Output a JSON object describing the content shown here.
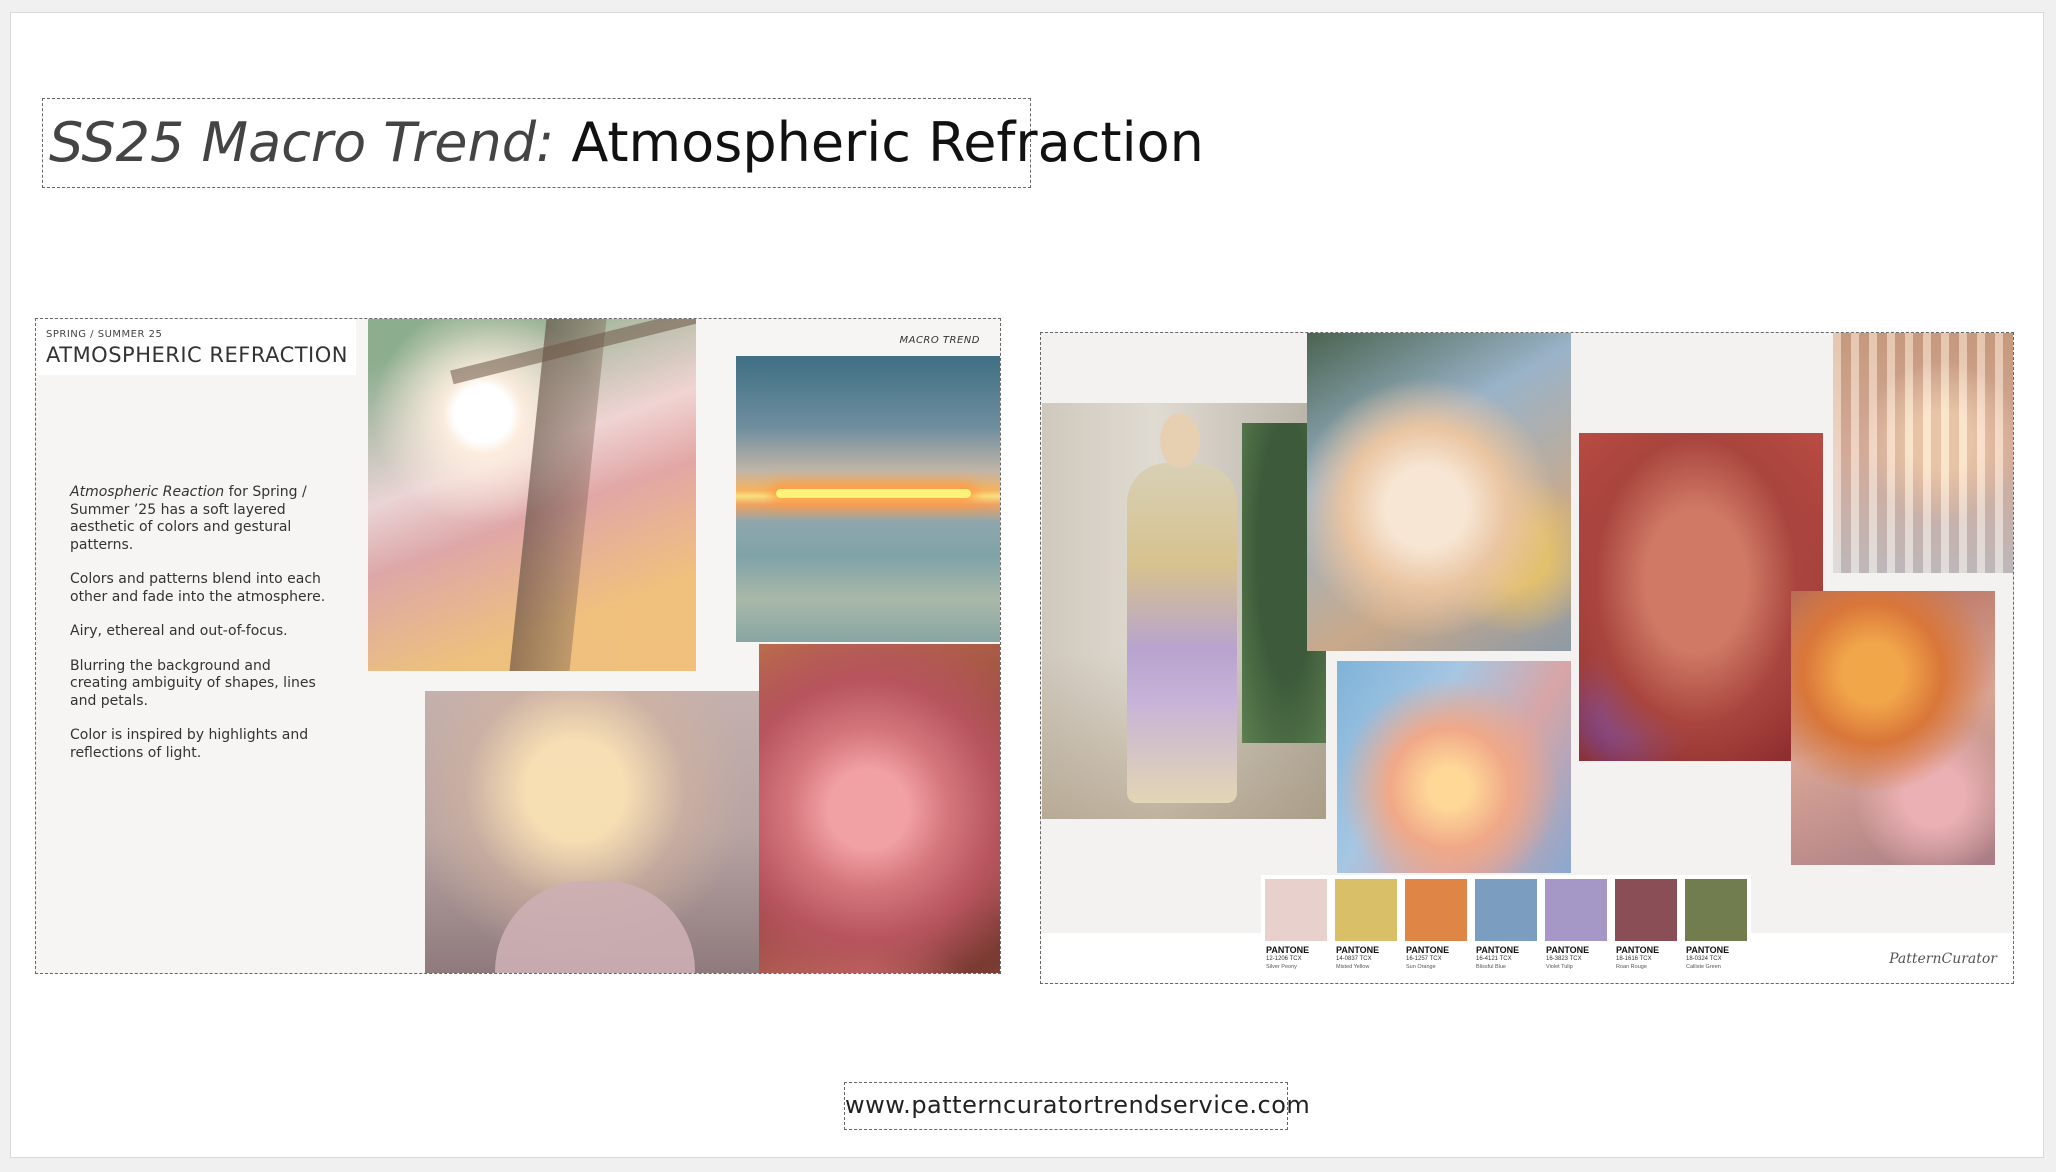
{
  "title": {
    "prefix": "SS25 Macro Trend:",
    "main": "Atmospheric Refraction"
  },
  "left_board": {
    "season": "SPRING / SUMMER 25",
    "heading": "ATMOSPHERIC REFRACTION",
    "label": "MACRO TREND",
    "intro_em": "Atmospheric Reaction",
    "intro_rest": " for Spring / Summer ’25 has a soft layered aesthetic of colors and gestural patterns.",
    "paragraphs": [
      "Colors and patterns blend into each other and fade into the atmosphere.",
      "Airy, ethereal and out-of-focus.",
      "Blurring the background and creating ambiguity of shapes, lines and petals.",
      "Color is inspired by highlights and reflections of light."
    ]
  },
  "right_board": {
    "signature": "PatternCurator",
    "swatches": [
      {
        "brand": "PANTONE",
        "code": "12-1206 TCX",
        "name": "Silver Peony",
        "color": "#e8d0cd"
      },
      {
        "brand": "PANTONE",
        "code": "14-0837 TCX",
        "name": "Misted Yellow",
        "color": "#d9bf68"
      },
      {
        "brand": "PANTONE",
        "code": "16-1257 TCX",
        "name": "Sun Orange",
        "color": "#df8647"
      },
      {
        "brand": "PANTONE",
        "code": "16-4121 TCX",
        "name": "Blissful Blue",
        "color": "#7b9dc0"
      },
      {
        "brand": "PANTONE",
        "code": "16-3823 TCX",
        "name": "Violet Tulip",
        "color": "#a698c6"
      },
      {
        "brand": "PANTONE",
        "code": "18-1616 TCX",
        "name": "Roan Rouge",
        "color": "#8a4e56"
      },
      {
        "brand": "PANTONE",
        "code": "18-0324 TCX",
        "name": "Calliste Green",
        "color": "#717d4e"
      }
    ]
  },
  "footer": {
    "url": "www.patterncuratortrendservice.com"
  }
}
